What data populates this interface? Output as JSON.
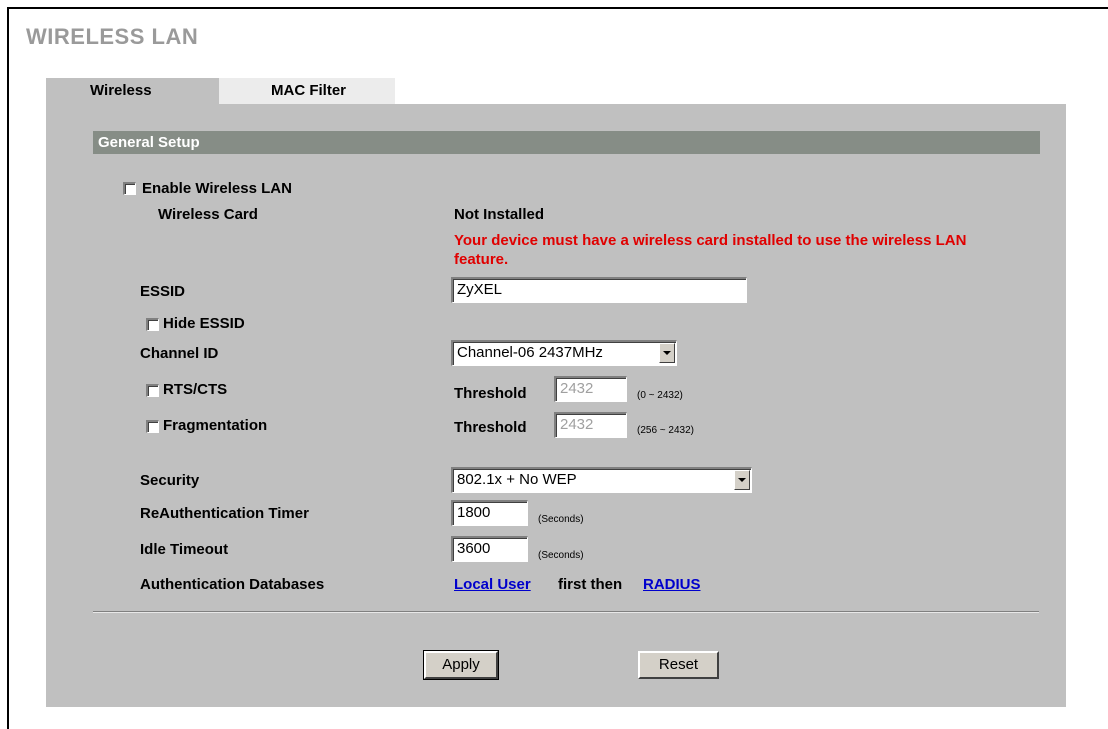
{
  "page": {
    "title": "WIRELESS LAN"
  },
  "tabs": [
    {
      "label": "Wireless",
      "active": true
    },
    {
      "label": "MAC Filter",
      "active": false
    }
  ],
  "section": {
    "title": "General Setup"
  },
  "form": {
    "enable_wireless": {
      "label": "Enable Wireless LAN",
      "checked": false
    },
    "wireless_card": {
      "label": "Wireless Card",
      "value": "Not Installed",
      "warning": "Your device must have a wireless card installed to use the wireless LAN feature."
    },
    "essid": {
      "label": "ESSID",
      "value": "ZyXEL"
    },
    "hide_essid": {
      "label": "Hide ESSID",
      "checked": false
    },
    "channel": {
      "label": "Channel ID",
      "value": "Channel-06 2437MHz"
    },
    "rts_cts": {
      "label": "RTS/CTS",
      "checked": false,
      "threshold_label": "Threshold",
      "threshold_value": "2432",
      "range": "(0 ~ 2432)"
    },
    "fragmentation": {
      "label": "Fragmentation",
      "checked": false,
      "threshold_label": "Threshold",
      "threshold_value": "2432",
      "range": "(256 ~ 2432)"
    },
    "security": {
      "label": "Security",
      "value": "802.1x + No WEP"
    },
    "reauth_timer": {
      "label": "ReAuthentication Timer",
      "value": "1800",
      "unit": "(Seconds)"
    },
    "idle_timeout": {
      "label": "Idle Timeout",
      "value": "3600",
      "unit": "(Seconds)"
    },
    "auth_db": {
      "label": "Authentication Databases",
      "link1": "Local User",
      "middle": "first then",
      "link2": "RADIUS"
    }
  },
  "buttons": {
    "apply": "Apply",
    "reset": "Reset"
  }
}
